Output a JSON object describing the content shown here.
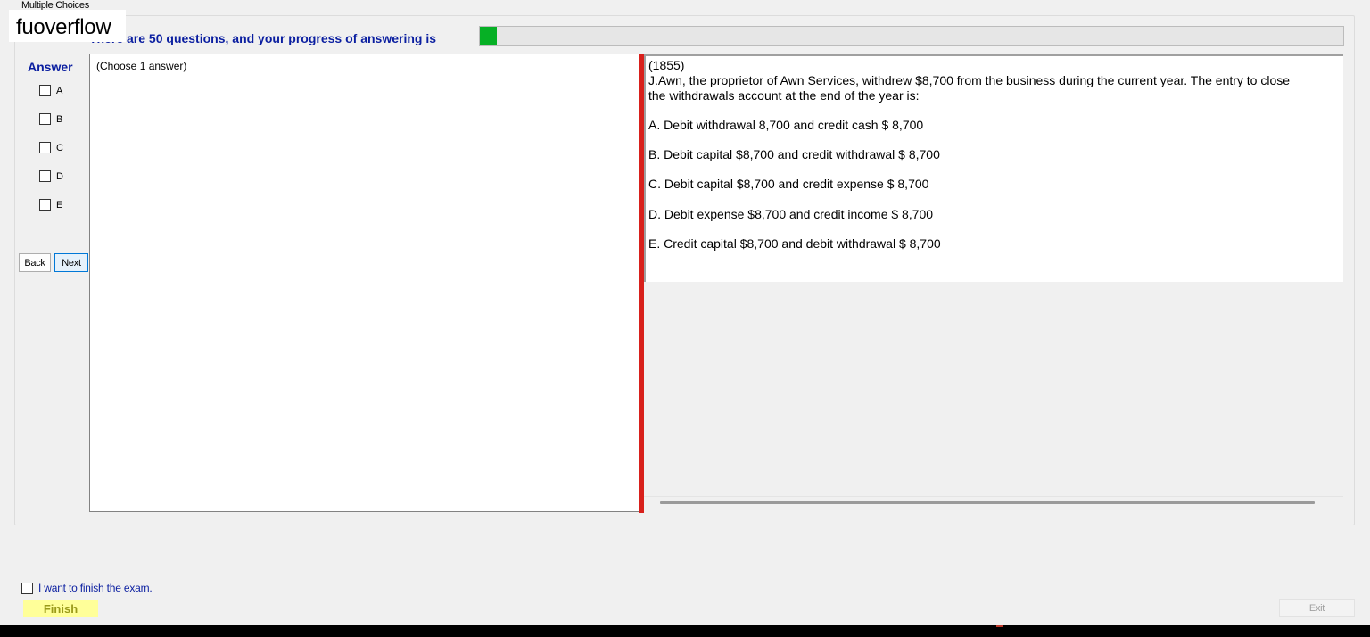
{
  "group": {
    "title": "Multiple Choices"
  },
  "watermark": {
    "text": "fuoverflow"
  },
  "progress": {
    "label": "There are 50 questions, and your progress of answering is",
    "value_fraction": 0.02,
    "fill_color": "#06b025"
  },
  "answer": {
    "title": "Answer",
    "options": [
      "A",
      "B",
      "C",
      "D",
      "E"
    ]
  },
  "nav": {
    "back_label": "Back",
    "next_label": "Next"
  },
  "answer_pane": {
    "hint": "(Choose 1 answer)"
  },
  "question": {
    "number": "(1855)",
    "text": "J.Awn, the proprietor of Awn Services, withdrew $8,700 from the business during the current year. The entry to close the withdrawals account at the end of the year is:",
    "choices": [
      "A.  Debit withdrawal 8,700 and credit cash $ 8,700",
      "B.  Debit capital $8,700 and credit withdrawal $ 8,700",
      "C.  Debit capital $8,700 and credit expense $ 8,700",
      "D.  Debit expense $8,700 and credit income $ 8,700",
      "E.  Credit capital $8,700 and debit withdrawal $ 8,700"
    ]
  },
  "footer": {
    "finish_check_label": "I want to finish the exam.",
    "finish_label": "Finish",
    "exit_label": "Exit"
  },
  "colors": {
    "accent_blue": "#0a1ea0",
    "splitter_red": "#d8201b",
    "finish_yellow": "#ffff99"
  }
}
